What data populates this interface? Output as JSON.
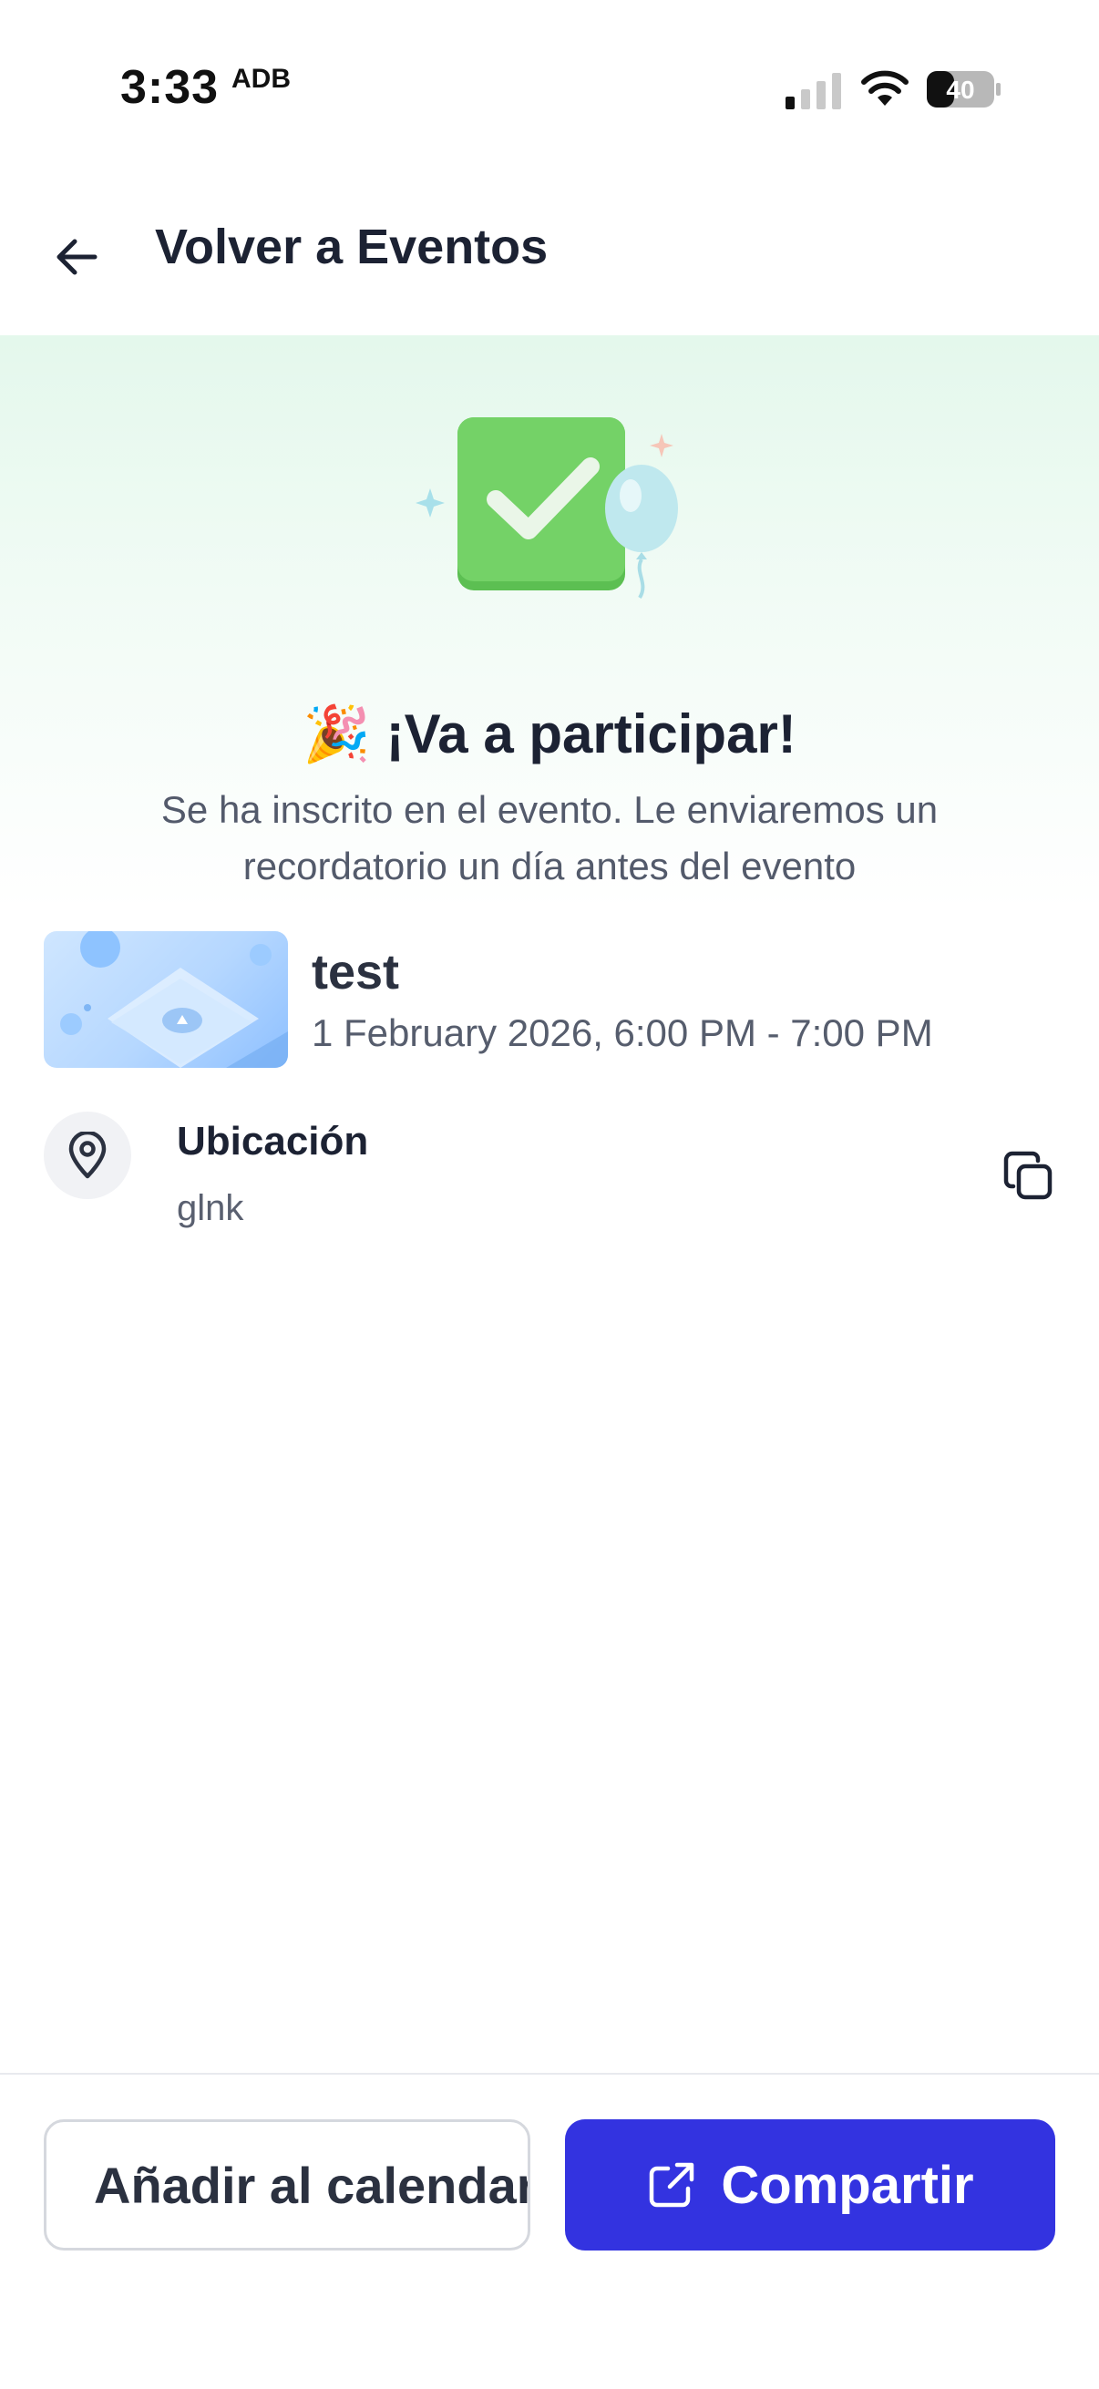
{
  "status_bar": {
    "time": "3:33",
    "extra": "ADB",
    "battery": "40"
  },
  "header": {
    "title": "Volver a Eventos",
    "back_icon": "arrow-left-icon"
  },
  "hero": {
    "emoji": "🎉",
    "title": "¡Va a participar!",
    "subtitle": "Se ha inscrito en el evento. Le enviaremos un recordatorio un día antes del evento",
    "illustration": "checkmark-balloon-illustration"
  },
  "event": {
    "name": "test",
    "datetime": "1 February 2026, 6:00 PM - 7:00 PM"
  },
  "location": {
    "label": "Ubicación",
    "value": "glnk",
    "icon": "map-pin-icon",
    "action_icon": "copy-icon"
  },
  "actions": {
    "calendar_label": "Añadir al calendario",
    "share_label": "Compartir",
    "share_icon": "external-link-icon"
  },
  "colors": {
    "primary": "#3333e0",
    "hero_green": "#e4f8ec",
    "check_green": "#6ecf63"
  }
}
